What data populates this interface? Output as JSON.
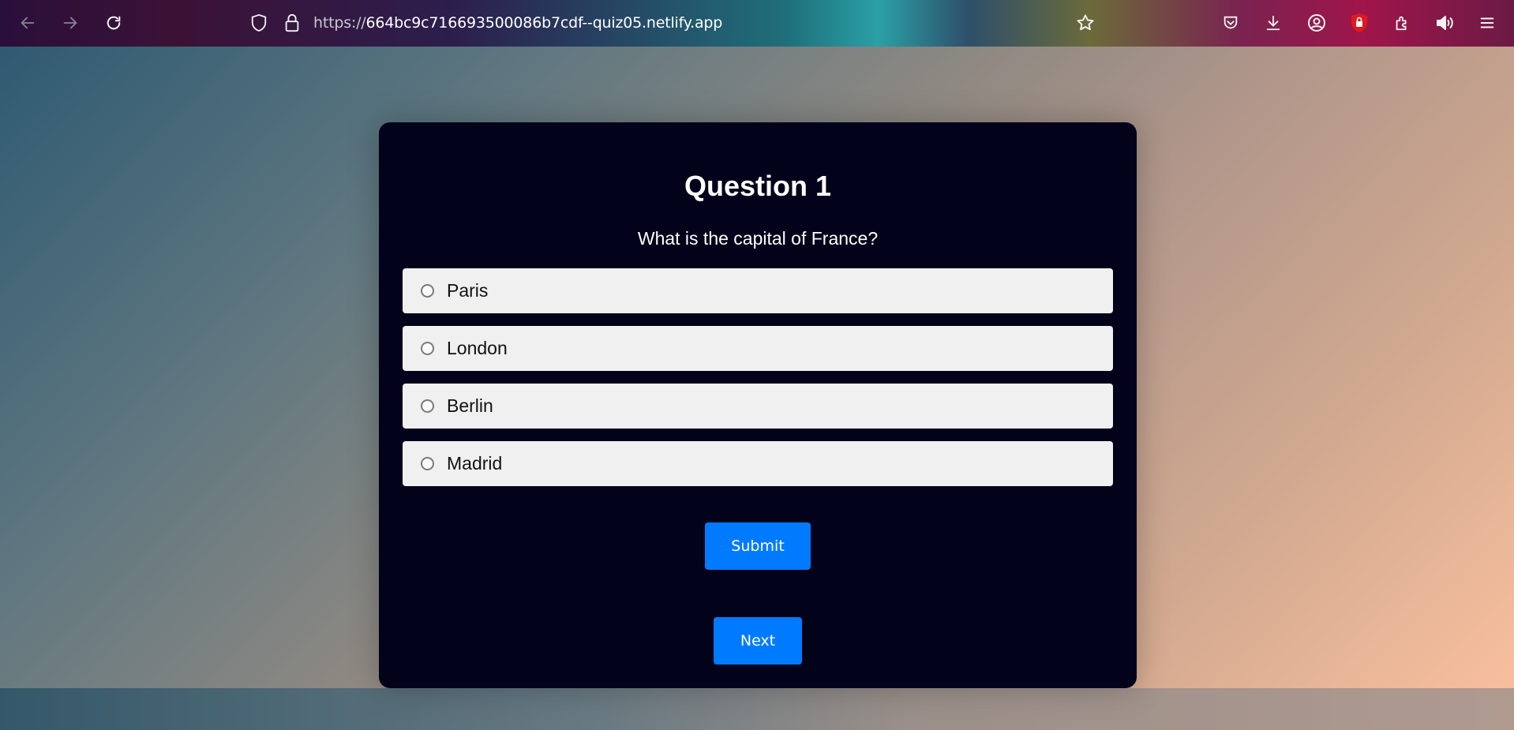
{
  "browser": {
    "url_protocol": "https://",
    "url_host": "664bc9c716693500086b7cdf--quiz05.netlify.app",
    "icons": [
      "back-icon",
      "forward-icon",
      "reload-icon",
      "shield-icon",
      "lock-icon",
      "bookmark-star-icon",
      "pocket-icon",
      "download-icon",
      "account-icon",
      "ublock-icon",
      "extensions-icon",
      "speaker-icon",
      "menu-icon"
    ]
  },
  "quiz": {
    "title": "Question 1",
    "question": "What is the capital of France?",
    "options": [
      "Paris",
      "London",
      "Berlin",
      "Madrid"
    ],
    "submit_label": "Submit",
    "next_label": "Next"
  },
  "colors": {
    "card": "#02021a",
    "button": "#007bff",
    "option_bg": "#f0f0f0"
  }
}
